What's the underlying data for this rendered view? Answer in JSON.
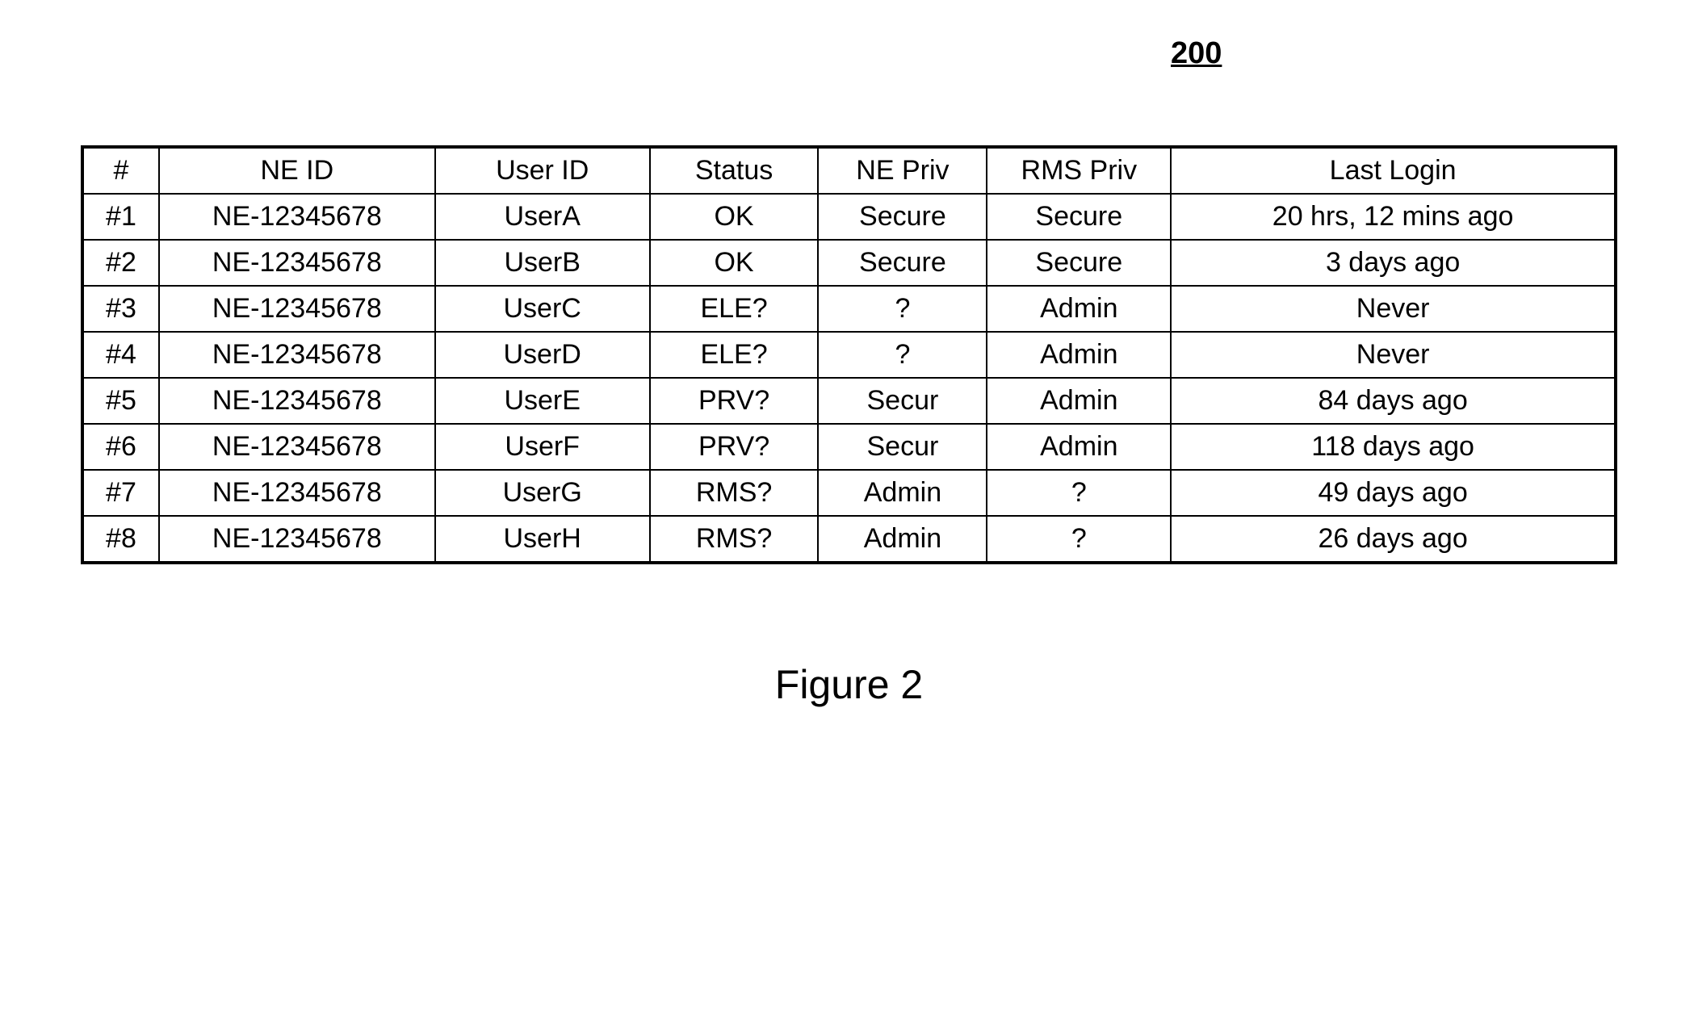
{
  "figureNumber": "200",
  "caption": "Figure 2",
  "table": {
    "headers": [
      "#",
      "NE ID",
      "User ID",
      "Status",
      "NE Priv",
      "RMS Priv",
      "Last Login"
    ],
    "rows": [
      {
        "num": "#1",
        "neid": "NE-12345678",
        "uid": "UserA",
        "status": "OK",
        "nep": "Secure",
        "rms": "Secure",
        "last": "20 hrs, 12 mins ago"
      },
      {
        "num": "#2",
        "neid": "NE-12345678",
        "uid": "UserB",
        "status": "OK",
        "nep": "Secure",
        "rms": "Secure",
        "last": "3 days ago"
      },
      {
        "num": "#3",
        "neid": "NE-12345678",
        "uid": "UserC",
        "status": "ELE?",
        "nep": "?",
        "rms": "Admin",
        "last": "Never"
      },
      {
        "num": "#4",
        "neid": "NE-12345678",
        "uid": "UserD",
        "status": "ELE?",
        "nep": "?",
        "rms": "Admin",
        "last": "Never"
      },
      {
        "num": "#5",
        "neid": "NE-12345678",
        "uid": "UserE",
        "status": "PRV?",
        "nep": "Secur",
        "rms": "Admin",
        "last": "84 days ago"
      },
      {
        "num": "#6",
        "neid": "NE-12345678",
        "uid": "UserF",
        "status": "PRV?",
        "nep": "Secur",
        "rms": "Admin",
        "last": "118 days ago"
      },
      {
        "num": "#7",
        "neid": "NE-12345678",
        "uid": "UserG",
        "status": "RMS?",
        "nep": "Admin",
        "rms": "?",
        "last": "49 days ago"
      },
      {
        "num": "#8",
        "neid": "NE-12345678",
        "uid": "UserH",
        "status": "RMS?",
        "nep": "Admin",
        "rms": "?",
        "last": "26 days ago"
      }
    ]
  }
}
